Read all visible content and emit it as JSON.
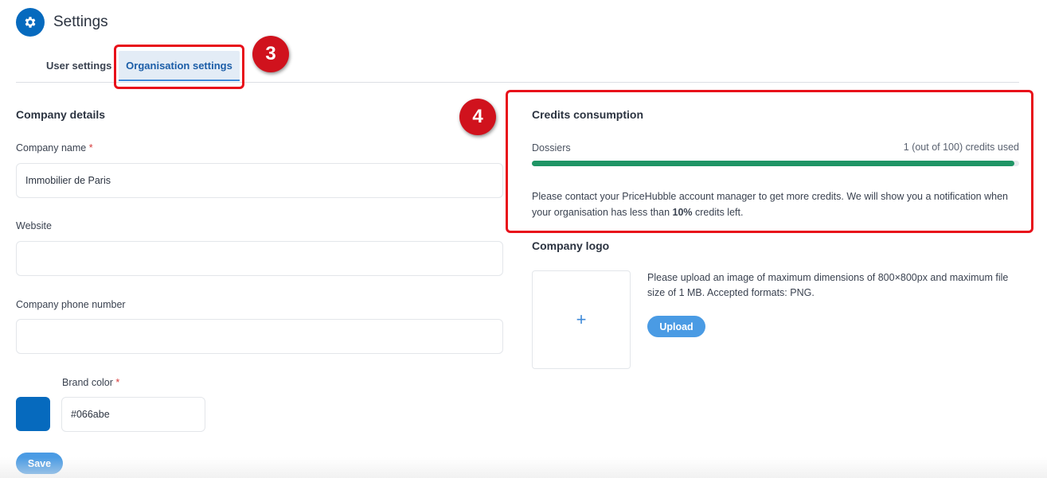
{
  "header": {
    "title": "Settings",
    "icon": "gear-icon",
    "accent": "#066abe"
  },
  "tabs": [
    {
      "label": "User settings",
      "active": false
    },
    {
      "label": "Organisation settings",
      "active": true
    }
  ],
  "annotations": {
    "badge_tabs": "3",
    "badge_credits": "4",
    "color": "#e8101a"
  },
  "company_details": {
    "title": "Company details",
    "name_label": "Company name",
    "name_value": "Immobilier de Paris",
    "website_label": "Website",
    "website_value": "",
    "phone_label": "Company phone number",
    "phone_value": "",
    "brand_label": "Brand color",
    "brand_value": "#066abe",
    "required_mark": "*",
    "save_label": "Save"
  },
  "credits": {
    "title": "Credits consumption",
    "row_label": "Dossiers",
    "used_text": "1 (out of 100) credits used",
    "used_fraction": 0.99,
    "bar_color": "#1f9565",
    "note_part1": "Please contact your PriceHubble account manager to get more credits. We will show you a notification when your organisation has less than ",
    "note_bold": "10%",
    "note_part2": " credits left."
  },
  "company_logo": {
    "title": "Company logo",
    "add_symbol": "+",
    "instructions": "Please upload an image of maximum dimensions of 800×800px and maximum file size of 1 MB. Accepted formats: PNG.",
    "upload_label": "Upload"
  }
}
